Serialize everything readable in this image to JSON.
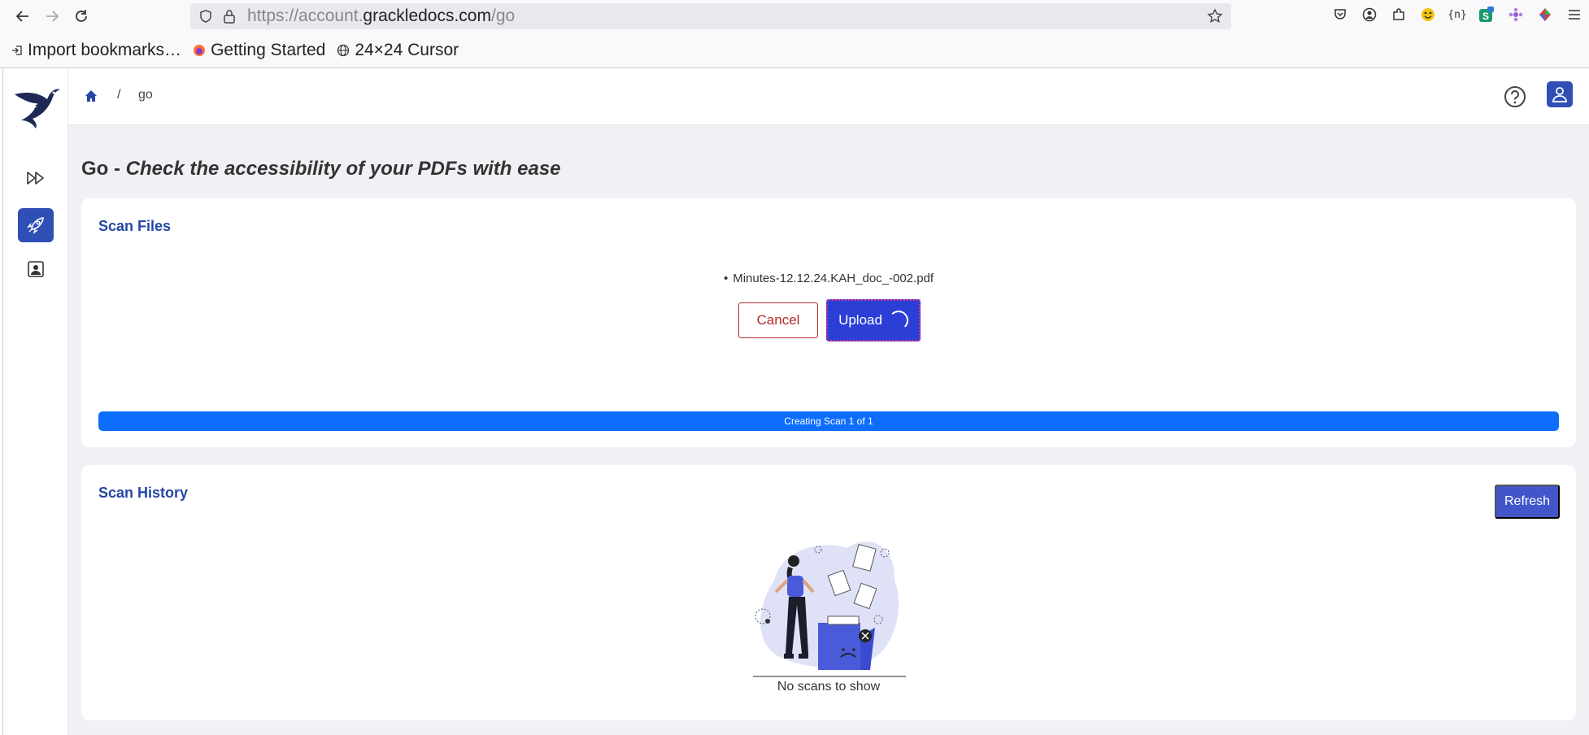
{
  "browser": {
    "url_prefix": "https://account.",
    "url_host": "grackledocs.com",
    "url_path": "/go",
    "bookmarks": [
      {
        "label": "Import bookmarks…",
        "icon": "import-icon"
      },
      {
        "label": "Getting Started",
        "icon": "firefox-icon"
      },
      {
        "label": "24×24 Cursor",
        "icon": "globe-icon"
      }
    ]
  },
  "breadcrumb": {
    "separator": "/",
    "current": "go"
  },
  "page": {
    "title_prefix": "Go - ",
    "title_sub": "Check the accessibility of your PDFs with ease"
  },
  "scan_files": {
    "title": "Scan Files",
    "file_name": "Minutes-12.12.24.KAH_doc_-002.pdf",
    "cancel_label": "Cancel",
    "upload_label": "Upload",
    "progress_text": "Creating Scan 1 of 1",
    "progress_percent": 100
  },
  "scan_history": {
    "title": "Scan History",
    "refresh_label": "Refresh",
    "empty_text": "No scans to show"
  },
  "colors": {
    "brand": "#2f4fb5",
    "progress": "#0d6efd",
    "cancel": "#b32a2a",
    "upload": "#2b3fd6"
  }
}
